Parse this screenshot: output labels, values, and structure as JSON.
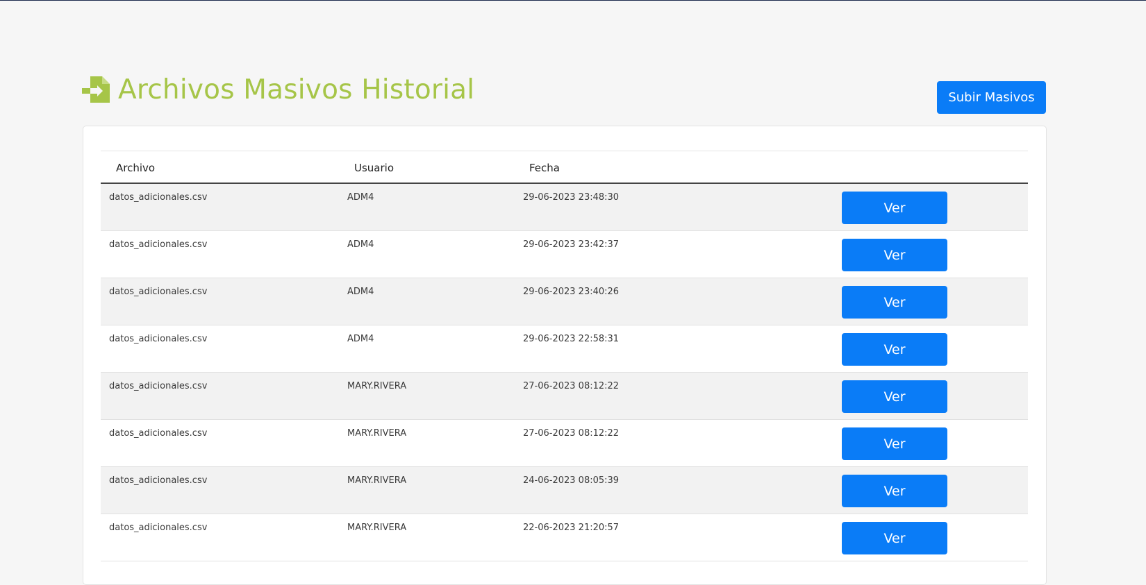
{
  "page": {
    "title": "Archivos Masivos Historial",
    "title_icon": "file-import-icon",
    "accent_color": "#a6c548",
    "button_color": "#0a7cf7"
  },
  "actions": {
    "upload_label": "Subir Masivos"
  },
  "table": {
    "headers": {
      "archivo": "Archivo",
      "usuario": "Usuario",
      "fecha": "Fecha"
    },
    "rows": [
      {
        "archivo": "datos_adicionales.csv",
        "usuario": "ADM4",
        "fecha": "29-06-2023 23:48:30",
        "action": "Ver"
      },
      {
        "archivo": "datos_adicionales.csv",
        "usuario": "ADM4",
        "fecha": "29-06-2023 23:42:37",
        "action": "Ver"
      },
      {
        "archivo": "datos_adicionales.csv",
        "usuario": "ADM4",
        "fecha": "29-06-2023 23:40:26",
        "action": "Ver"
      },
      {
        "archivo": "datos_adicionales.csv",
        "usuario": "ADM4",
        "fecha": "29-06-2023 22:58:31",
        "action": "Ver"
      },
      {
        "archivo": "datos_adicionales.csv",
        "usuario": "MARY.RIVERA",
        "fecha": "27-06-2023 08:12:22",
        "action": "Ver"
      },
      {
        "archivo": "datos_adicionales.csv",
        "usuario": "MARY.RIVERA",
        "fecha": "27-06-2023 08:12:22",
        "action": "Ver"
      },
      {
        "archivo": "datos_adicionales.csv",
        "usuario": "MARY.RIVERA",
        "fecha": "24-06-2023 08:05:39",
        "action": "Ver"
      },
      {
        "archivo": "datos_adicionales.csv",
        "usuario": "MARY.RIVERA",
        "fecha": "22-06-2023 21:20:57",
        "action": "Ver"
      }
    ]
  }
}
